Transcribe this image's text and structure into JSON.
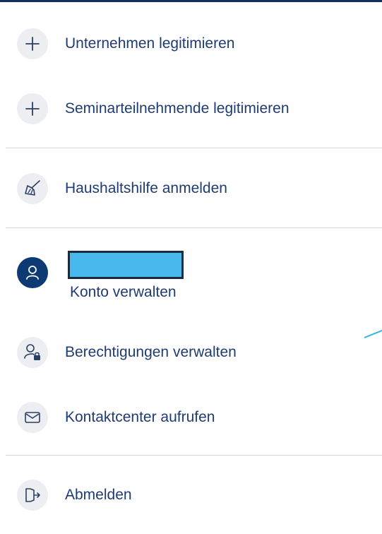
{
  "menu": {
    "items": [
      {
        "label": "Unternehmen legitimieren",
        "icon": "plus-icon"
      },
      {
        "label": "Seminarteilnehmende legitimieren",
        "icon": "plus-icon"
      },
      {
        "label": "Haushaltshilfe anmelden",
        "icon": "broom-icon"
      }
    ],
    "account": {
      "manage_label": "Konto verwalten"
    },
    "account_items": [
      {
        "label": "Berechtigungen verwalten",
        "icon": "user-lock-icon"
      },
      {
        "label": "Kontaktcenter aufrufen",
        "icon": "mail-icon"
      }
    ],
    "logout": {
      "label": "Abmelden",
      "icon": "logout-icon"
    }
  },
  "colors": {
    "text": "#1f3b73",
    "icon_bg": "#eceef1",
    "avatar_bg": "#0e3a74",
    "divider": "#d4d7dc",
    "redaction_fill": "#48b9ec"
  }
}
